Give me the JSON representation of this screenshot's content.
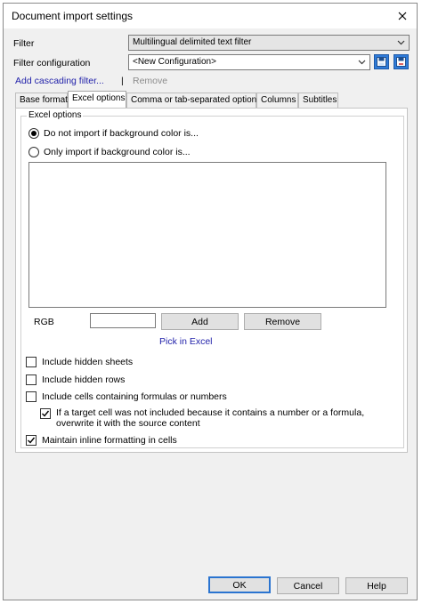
{
  "window": {
    "title": "Document import settings"
  },
  "filter": {
    "label": "Filter",
    "value": "Multilingual delimited text filter"
  },
  "filter_config": {
    "label": "Filter configuration",
    "value": "<New Configuration>"
  },
  "links": {
    "add_cascading": "Add cascading filter...",
    "separator": "|",
    "remove": "Remove"
  },
  "tabs": [
    {
      "label": "Base format"
    },
    {
      "label": "Excel options"
    },
    {
      "label": "Comma or tab-separated options"
    },
    {
      "label": "Columns"
    },
    {
      "label": "Subtitles"
    }
  ],
  "excel": {
    "group_title": "Excel options",
    "radio_not_import": "Do not import if background color is...",
    "radio_only_import": "Only import if background color is...",
    "rgb_label": "RGB",
    "rgb_value": "",
    "add_button": "Add",
    "remove_button": "Remove",
    "pick_link": "Pick in Excel",
    "hidden_sheets": "Include hidden sheets",
    "hidden_rows": "Include hidden rows",
    "formulas": "Include cells containing formulas or numbers",
    "overwrite": "If a target cell was not included because it contains a number or a formula, overwrite it with the source content",
    "inline_formatting": "Maintain inline formatting in cells"
  },
  "buttons": {
    "ok": "OK",
    "cancel": "Cancel",
    "help": "Help"
  }
}
